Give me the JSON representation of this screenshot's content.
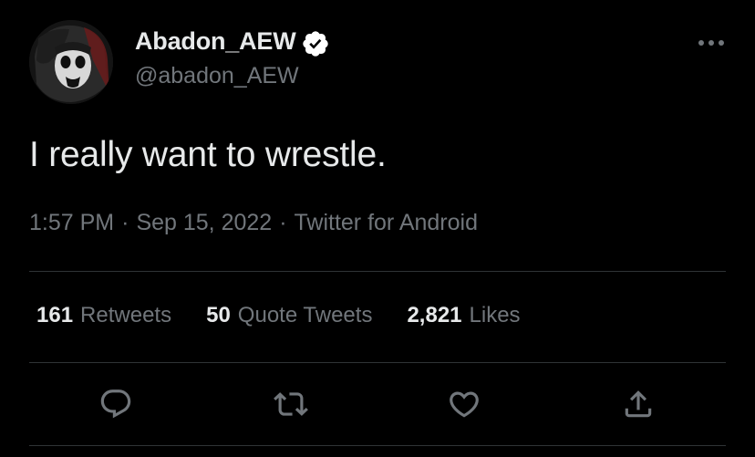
{
  "author": {
    "display_name": "Abadon_AEW",
    "handle": "@abadon_AEW",
    "verified": true,
    "avatar_icon": "avatar-photo"
  },
  "tweet": {
    "text": "I really want to wrestle.",
    "time": "1:57 PM",
    "date": "Sep 15, 2022",
    "source": "Twitter for Android",
    "separator": "·"
  },
  "stats": {
    "retweets": {
      "count": "161",
      "label": "Retweets"
    },
    "quotes": {
      "count": "50",
      "label": "Quote Tweets"
    },
    "likes": {
      "count": "2,821",
      "label": "Likes"
    }
  },
  "actions": [
    {
      "icon": "reply-icon"
    },
    {
      "icon": "retweet-icon"
    },
    {
      "icon": "like-icon"
    },
    {
      "icon": "share-icon"
    }
  ],
  "colors": {
    "background": "#000000",
    "primary_text": "#e7e9ea",
    "secondary_text": "#71767b",
    "divider": "#2f3336",
    "verified_badge": "#ffffff"
  }
}
